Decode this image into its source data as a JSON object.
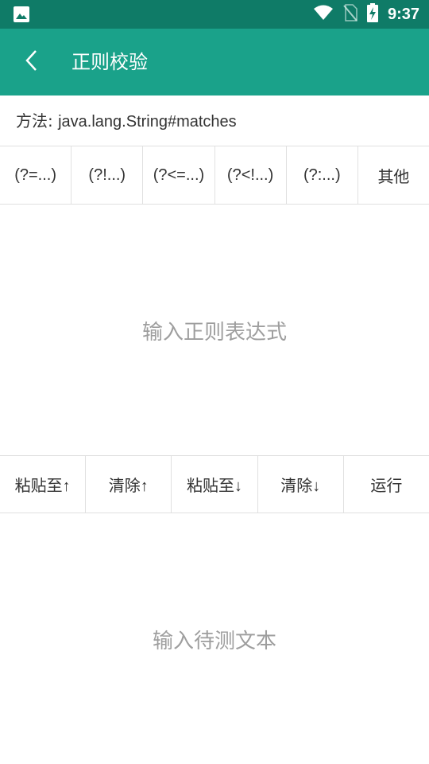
{
  "status_bar": {
    "time": "9:37",
    "icons": [
      "image-icon",
      "wifi-icon",
      "no-sim-icon",
      "battery-charging-icon"
    ]
  },
  "app_bar": {
    "title": "正则校验",
    "back_icon": "chevron-left-icon"
  },
  "method": {
    "label": "方法: ",
    "value": "java.lang.String#matches"
  },
  "regex_buttons": [
    "(?=...)",
    "(?!...)",
    "(?<=...)",
    "(?<!...)",
    "(?:...)",
    "其他"
  ],
  "regex_input": {
    "placeholder": "输入正则表达式",
    "value": ""
  },
  "action_buttons": [
    "粘贴至↑",
    "清除↑",
    "粘贴至↓",
    "清除↓",
    "运行"
  ],
  "test_input": {
    "placeholder": "输入待测文本",
    "value": ""
  },
  "colors": {
    "status_bar": "#0f7b67",
    "app_bar": "#1aa28a",
    "placeholder": "#9e9e9e",
    "divider": "#e0e0e0"
  }
}
